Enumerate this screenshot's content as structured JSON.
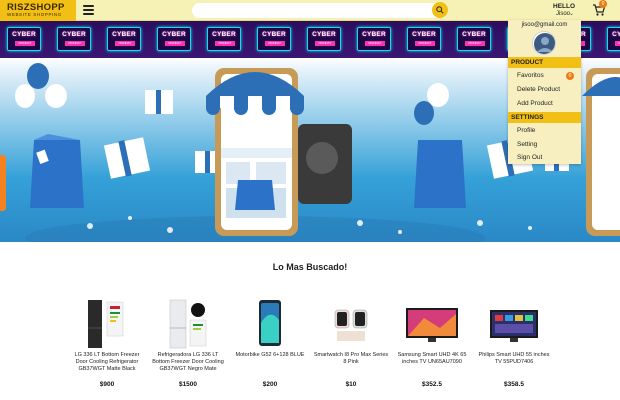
{
  "header": {
    "logo_main": "RISZSHOPP",
    "logo_sub": "WEBSITE SHOPPING",
    "menu_icon": "hamburger-icon",
    "search_placeholder": "",
    "search_icon": "search-icon",
    "greeting": "HELLO",
    "username": "Jisoo",
    "user_caret": "⌄",
    "cart_icon": "cart-icon",
    "cart_count": "0"
  },
  "cyber_banner": {
    "line1": "CYBER",
    "line2": "MONDAY"
  },
  "user_menu": {
    "email": "jisoo@gmail.com",
    "avatar_icon": "user-avatar-icon",
    "product_section": "PRODUCT",
    "favorites": "Favoritos",
    "favorites_count": "0",
    "delete_product": "Delete Product",
    "add_product": "Add Product",
    "settings_section": "SETTINGS",
    "profile": "Profile",
    "setting": "Setting",
    "sign_out": "Sign Out"
  },
  "section_title": "Lo Mas Buscado!",
  "products": [
    {
      "name": "LG 336 LT Bottom Freezer Door Cooling Refrigerator GB37WGT Matte Black",
      "price": "$900"
    },
    {
      "name": "Refrigeradora LG 336 LT Bottom Freezer Door Cooling GB37WGT Negro Mate",
      "price": "$1500"
    },
    {
      "name": "Motorbike G52 6+128 BLUE",
      "price": "$200"
    },
    {
      "name": "Smartwatch I8 Pro Max Series 8 Pink",
      "price": "$10"
    },
    {
      "name": "Samsung Smart UHD 4K 65 inches TV UN65AU7090",
      "price": "$352.5"
    },
    {
      "name": "Philips Smart UHD 55 inches TV 55PUD7406",
      "price": "$358.5"
    }
  ],
  "colors": {
    "accent": "#f2c015",
    "header_bg": "#f6f1b4",
    "banner_blue": "#35a1d8",
    "badge": "#f07a12",
    "cyber_bg": "#2b0d5e"
  }
}
